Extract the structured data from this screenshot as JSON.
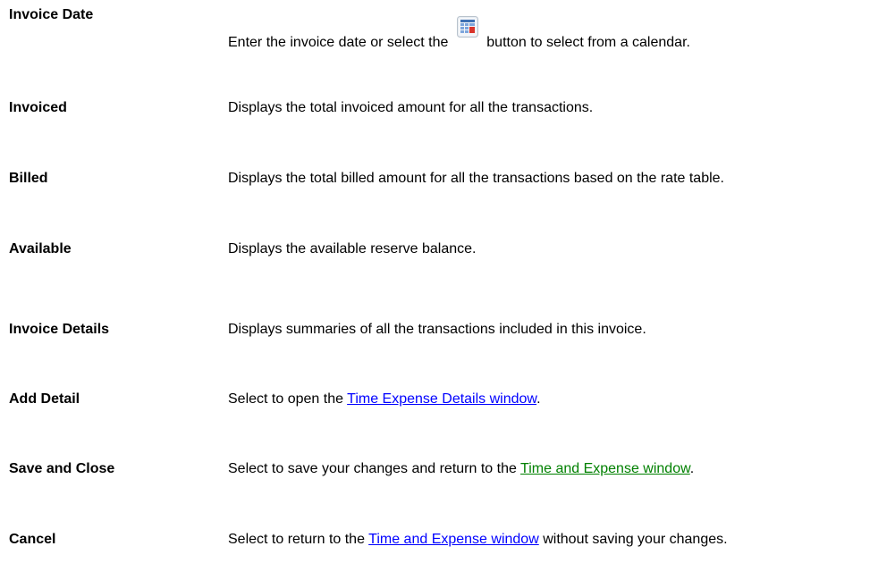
{
  "rows": [
    {
      "term": "Invoice Date",
      "desc_before": "Enter the invoice date or select the",
      "icon": "calendar-icon",
      "desc_after": "button to select from a calendar."
    },
    {
      "term": "Invoiced",
      "desc": "Displays the total invoiced amount for all the transactions."
    },
    {
      "term": "Billed",
      "desc": "Displays the total billed amount for all the transactions based on the rate table."
    },
    {
      "term": "Available",
      "desc": "Displays the available reserve balance."
    },
    {
      "term": "Invoice Details",
      "desc": "Displays summaries of all the transactions included in this invoice."
    },
    {
      "term": "Add Detail",
      "desc_before": "Select to open the",
      "link": "Time Expense Details window",
      "desc_after": "."
    },
    {
      "term": "Save and Close",
      "desc_before": "Select to save your changes and return to the",
      "link": "Time and Expense window",
      "desc_after": "."
    },
    {
      "term": "Cancel",
      "desc_before": "Select to return to the",
      "link": "Time and Expense window",
      "desc_after": "without saving your changes."
    }
  ],
  "colors": {
    "link_blue": "#0000ff",
    "link_green": "#008000",
    "text": "#000000"
  }
}
